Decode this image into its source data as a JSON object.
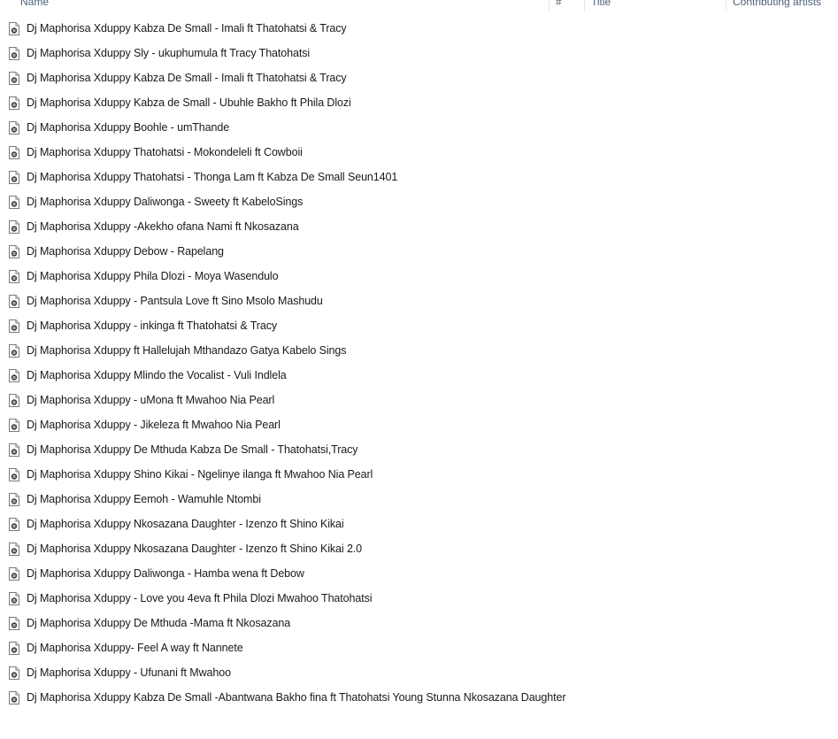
{
  "columns": {
    "name": "Name",
    "number": "#",
    "title": "Title",
    "contributing_artists": "Contributing artists"
  },
  "files": [
    {
      "name": "Dj Maphorisa Xduppy Kabza De Small - Imali  ft Thatohatsi & Tracy",
      "icon": "audio-file-icon"
    },
    {
      "name": "Dj Maphorisa Xduppy Sly - ukuphumula ft Tracy Thatohatsi",
      "icon": "audio-file-icon"
    },
    {
      "name": "Dj Maphorisa Xduppy Kabza De Small - Imali  ft Thatohatsi & Tracy",
      "icon": "audio-file-icon"
    },
    {
      "name": "Dj Maphorisa Xduppy Kabza de Small - Ubuhle Bakho ft Phila Dlozi",
      "icon": "audio-file-icon"
    },
    {
      "name": "Dj Maphorisa Xduppy Boohle - umThande",
      "icon": "audio-file-icon"
    },
    {
      "name": "Dj Maphorisa Xduppy Thatohatsi - Mokondeleli ft Cowboii",
      "icon": "audio-file-icon"
    },
    {
      "name": "Dj Maphorisa Xduppy Thatohatsi - Thonga Lam ft Kabza De Small Seun1401",
      "icon": "audio-file-icon"
    },
    {
      "name": "Dj Maphorisa Xduppy Daliwonga - Sweety ft KabeloSings",
      "icon": "audio-file-icon"
    },
    {
      "name": "Dj Maphorisa Xduppy -Akekho ofana Nami  ft Nkosazana",
      "icon": "audio-file-icon"
    },
    {
      "name": "Dj Maphorisa Xduppy Debow - Rapelang",
      "icon": "audio-file-icon"
    },
    {
      "name": "Dj Maphorisa Xduppy Phila Dlozi - Moya Wasendulo",
      "icon": "audio-file-icon"
    },
    {
      "name": "Dj Maphorisa Xduppy - Pantsula Love ft Sino Msolo Mashudu",
      "icon": "audio-file-icon"
    },
    {
      "name": "Dj Maphorisa Xduppy  - inkinga ft Thatohatsi & Tracy",
      "icon": "audio-file-icon"
    },
    {
      "name": "Dj Maphorisa Xduppy  ft Hallelujah Mthandazo Gatya Kabelo Sings",
      "icon": "audio-file-icon"
    },
    {
      "name": "Dj Maphorisa Xduppy Mlindo the Vocalist - Vuli Indlela",
      "icon": "audio-file-icon"
    },
    {
      "name": "Dj Maphorisa Xduppy - uMona ft Mwahoo Nia Pearl",
      "icon": "audio-file-icon"
    },
    {
      "name": "Dj Maphorisa Xduppy - Jikeleza ft Mwahoo Nia Pearl",
      "icon": "audio-file-icon"
    },
    {
      "name": "Dj Maphorisa Xduppy De Mthuda Kabza De Small - Thatohatsi,Tracy",
      "icon": "audio-file-icon"
    },
    {
      "name": "Dj Maphorisa Xduppy Shino Kikai - Ngelinye ilanga ft Mwahoo Nia Pearl",
      "icon": "audio-file-icon"
    },
    {
      "name": "Dj Maphorisa Xduppy Eemoh - Wamuhle Ntombi",
      "icon": "audio-file-icon"
    },
    {
      "name": "Dj Maphorisa Xduppy Nkosazana Daughter - Izenzo ft Shino Kikai",
      "icon": "audio-file-icon"
    },
    {
      "name": "Dj Maphorisa Xduppy Nkosazana Daughter - Izenzo ft Shino Kikai 2.0",
      "icon": "audio-file-icon"
    },
    {
      "name": "Dj Maphorisa Xduppy Daliwonga  - Hamba wena ft Debow",
      "icon": "audio-file-icon"
    },
    {
      "name": "Dj Maphorisa Xduppy - Love you 4eva ft Phila Dlozi Mwahoo Thatohatsi",
      "icon": "audio-file-icon"
    },
    {
      "name": "Dj Maphorisa Xduppy De Mthuda -Mama ft Nkosazana",
      "icon": "audio-file-icon"
    },
    {
      "name": "Dj Maphorisa Xduppy- Feel A way ft Nannete",
      "icon": "audio-file-icon"
    },
    {
      "name": "Dj Maphorisa Xduppy - Ufunani ft Mwahoo",
      "icon": "audio-file-icon"
    },
    {
      "name": "Dj Maphorisa Xduppy Kabza De Small -Abantwana Bakho fina ft Thatohatsi Young Stunna Nkosazana Daughter",
      "icon": "audio-file-icon"
    }
  ]
}
